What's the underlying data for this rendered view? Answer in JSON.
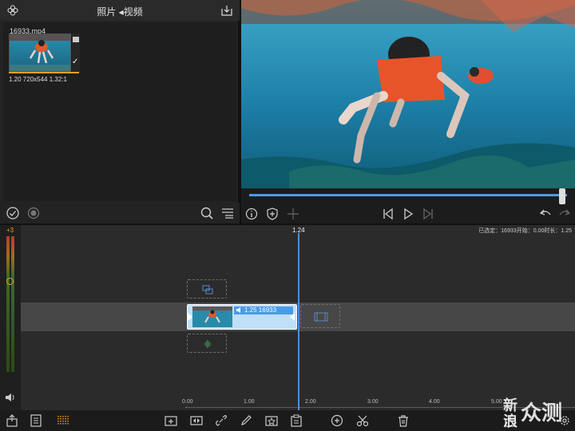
{
  "browser": {
    "title": "照片 ◂视频",
    "clip": {
      "filename": "16933.mp4",
      "meta": "1.20  720x544  1.32:1",
      "checked_mark": "✓"
    }
  },
  "timeline": {
    "meter_label": "+3",
    "playhead_time": "1.24",
    "selection_info": "已选定：16933开始：0.00时长：1.25",
    "clip_label": "1.25  16933",
    "ruler_ticks": [
      "0.00",
      "1.00",
      "2.00",
      "3.00",
      "4.00",
      "5.00"
    ]
  },
  "watermark": {
    "text": "新 众测",
    "sub": "浪"
  },
  "playback": {
    "progress": 0.99
  },
  "colors": {
    "accent_blue": "#4b9be8",
    "accent_orange": "#f0a020",
    "clip_fill": "#bfe0f8"
  },
  "icons": {
    "browser_header": [
      "flower-icon",
      "import-icon"
    ],
    "browser_toolbar": [
      "checkmark-circle-icon",
      "record-icon",
      "search-zoom-icon",
      "list-options-icon"
    ],
    "preview_toolbar": [
      "info-icon",
      "shield-icon",
      "move-icon",
      "skip-back-icon",
      "play-icon",
      "skip-forward-icon",
      "undo-icon",
      "redo-icon"
    ],
    "bottom_toolbar": [
      "export-icon",
      "list-icon",
      "audio-meter-icon",
      "add-clip-icon",
      "transition-icon",
      "link-icon",
      "pen-icon",
      "favorite-icon",
      "clipboard-icon",
      "plus-circle-icon",
      "scissors-icon",
      "trash-icon",
      "share-icon",
      "settings-icon"
    ]
  }
}
